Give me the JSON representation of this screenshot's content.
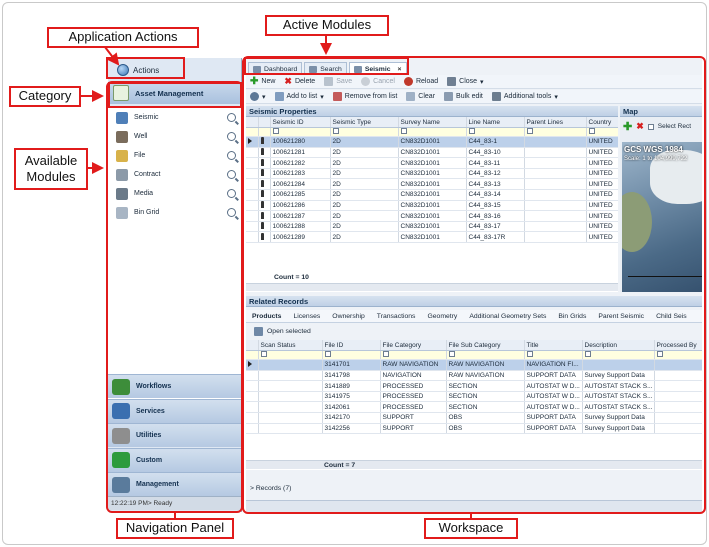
{
  "annotations": {
    "application_actions": "Application Actions",
    "active_modules": "Active Modules",
    "category": "Category",
    "available_modules": "Available\nModules",
    "navigation_panel": "Navigation Panel",
    "workspace": "Workspace",
    "accent": "#e11b1b"
  },
  "nav": {
    "actions_label": "Actions",
    "category_label": "Asset Management",
    "modules": [
      {
        "label": "Seismic",
        "icon": "seismic-icon",
        "color": "#4f7fb8"
      },
      {
        "label": "Well",
        "icon": "well-icon",
        "color": "#7a6c5c"
      },
      {
        "label": "File",
        "icon": "folder-icon",
        "color": "#d8b24a"
      },
      {
        "label": "Contract",
        "icon": "contract-icon",
        "color": "#8c9aa8"
      },
      {
        "label": "Media",
        "icon": "media-icon",
        "color": "#6b7a89"
      },
      {
        "label": "Bin Grid",
        "icon": "bin-grid-icon",
        "color": "#a8b5c4"
      }
    ],
    "categories": [
      {
        "label": "Workflows",
        "icon": "workflows-icon",
        "color": "#3d8d3a"
      },
      {
        "label": "Services",
        "icon": "services-icon",
        "color": "#3a6fb0"
      },
      {
        "label": "Utilities",
        "icon": "utilities-icon",
        "color": "#8e8e8e"
      },
      {
        "label": "Custom",
        "icon": "custom-icon",
        "color": "#2d9b3d"
      },
      {
        "label": "Management",
        "icon": "management-icon",
        "color": "#5a7b9c"
      }
    ],
    "status": "12:22:19 PM> Ready"
  },
  "tabs": [
    {
      "label": "Dashboard",
      "active": false
    },
    {
      "label": "Search",
      "active": false
    },
    {
      "label": "Seismic",
      "active": true
    }
  ],
  "toolbar1": {
    "new": "New",
    "delete": "Delete",
    "save": "Save",
    "cancel": "Cancel",
    "reload": "Reload",
    "close": "Close"
  },
  "toolbar2": {
    "add_to_list": "Add to list",
    "remove_from_list": "Remove from list",
    "clear": "Clear",
    "bulk_edit": "Bulk edit",
    "additional_tools": "Additional tools"
  },
  "seismic": {
    "title": "Seismic Properties",
    "columns": [
      "Seismic ID",
      "Seismic Type",
      "Survey Name",
      "Line Name",
      "Parent Lines",
      "Country"
    ],
    "rows": [
      [
        "100621280",
        "2D",
        "CN832D1001",
        "C44_83-1",
        "",
        "UNITED"
      ],
      [
        "100621281",
        "2D",
        "CN832D1001",
        "C44_83-10",
        "",
        "UNITED"
      ],
      [
        "100621282",
        "2D",
        "CN832D1001",
        "C44_83-11",
        "",
        "UNITED"
      ],
      [
        "100621283",
        "2D",
        "CN832D1001",
        "C44_83-12",
        "",
        "UNITED"
      ],
      [
        "100621284",
        "2D",
        "CN832D1001",
        "C44_83-13",
        "",
        "UNITED"
      ],
      [
        "100621285",
        "2D",
        "CN832D1001",
        "C44_83-14",
        "",
        "UNITED"
      ],
      [
        "100621286",
        "2D",
        "CN832D1001",
        "C44_83-15",
        "",
        "UNITED"
      ],
      [
        "100621287",
        "2D",
        "CN832D1001",
        "C44_83-16",
        "",
        "UNITED"
      ],
      [
        "100621288",
        "2D",
        "CN832D1001",
        "C44_83-17",
        "",
        "UNITED"
      ],
      [
        "100621289",
        "2D",
        "CN832D1001",
        "C44_83-17R",
        "",
        "UNITED"
      ]
    ],
    "count": "Count = 10"
  },
  "map": {
    "title": "Map",
    "select_label": "Select Rect",
    "projection": "GCS WGS 1984",
    "scale": "Scale: 1 to 104,999,722"
  },
  "related": {
    "title": "Related Records",
    "tabs": [
      "Products",
      "Licenses",
      "Ownership",
      "Transactions",
      "Geometry",
      "Additional Geometry Sets",
      "Bin Grids",
      "Parent Seismic",
      "Child Seis"
    ],
    "open_selected": "Open selected",
    "columns": [
      "Scan Status",
      "File ID",
      "File Category",
      "File Sub Category",
      "Title",
      "Description",
      "Processed By"
    ],
    "rows": [
      [
        "",
        "3141701",
        "RAW NAVIGATION",
        "RAW NAVIGATION",
        "NAVIGATION FI...",
        "",
        ""
      ],
      [
        "",
        "3141798",
        "NAVIGATION",
        "RAW NAVIGATION",
        "SUPPORT DATA",
        "Survey Support Data",
        ""
      ],
      [
        "",
        "3141889",
        "PROCESSED",
        "SECTION",
        "AUTOSTAT W D...",
        "AUTOSTAT STACK S...",
        ""
      ],
      [
        "",
        "3141975",
        "PROCESSED",
        "SECTION",
        "AUTOSTAT W D...",
        "AUTOSTAT STACK S...",
        ""
      ],
      [
        "",
        "3142061",
        "PROCESSED",
        "SECTION",
        "AUTOSTAT W D...",
        "AUTOSTAT STACK S...",
        ""
      ],
      [
        "",
        "3142170",
        "SUPPORT",
        "OBS",
        "SUPPORT DATA",
        "Survey Support Data",
        ""
      ],
      [
        "",
        "3142256",
        "SUPPORT",
        "OBS",
        "SUPPORT DATA",
        "Survey Support Data",
        ""
      ]
    ],
    "count": "Count = 7",
    "records": "> Records (7)"
  }
}
